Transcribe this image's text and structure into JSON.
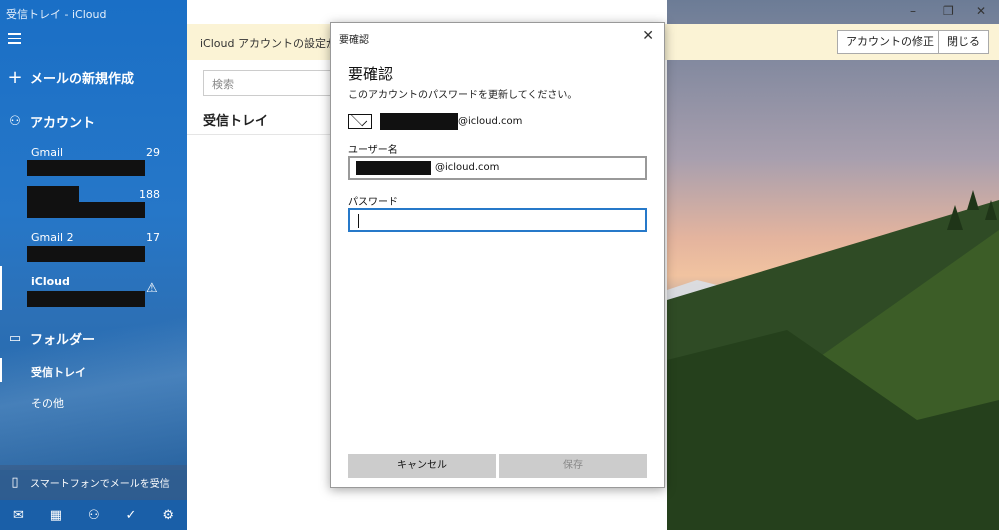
{
  "window": {
    "title": "受信トレイ - iCloud"
  },
  "sidebar": {
    "new_mail": "メールの新規作成",
    "accounts_label": "アカウント",
    "accounts": [
      {
        "name": "Gmail",
        "count": "29"
      },
      {
        "name": "",
        "count": "188"
      },
      {
        "name": "Gmail 2",
        "count": "17"
      },
      {
        "name": "iCloud",
        "count": ""
      }
    ],
    "folders_label": "フォルダー",
    "folders": [
      {
        "label": "受信トレイ"
      },
      {
        "label": "その他"
      }
    ],
    "phone_promo": "スマートフォンでメールを受信"
  },
  "notice": {
    "text": "iCloud アカウントの設定が最新",
    "fix_button": "アカウントの修正",
    "close_button": "閉じる"
  },
  "middle": {
    "search_placeholder": "検索",
    "list_title": "受信トレイ"
  },
  "dialog": {
    "title": "要確認",
    "heading": "要確認",
    "subtitle": "このアカウントのパスワードを更新してください。",
    "email_suffix": "@icloud.com",
    "username_label": "ユーザー名",
    "username_suffix": "@icloud.com",
    "password_label": "パスワード",
    "cancel": "キャンセル",
    "save": "保存"
  },
  "colors": {
    "accent": "#2679c9",
    "sidebar": "#1a6fc6",
    "notice_bg": "#fbf3d5"
  },
  "icons": [
    "hamburger-icon",
    "plus-icon",
    "person-icon",
    "folder-icon",
    "warning-icon",
    "phone-icon",
    "mail-icon",
    "calendar-icon",
    "people-icon",
    "todo-icon",
    "settings-icon",
    "close-icon",
    "minimize-icon",
    "restore-icon"
  ]
}
